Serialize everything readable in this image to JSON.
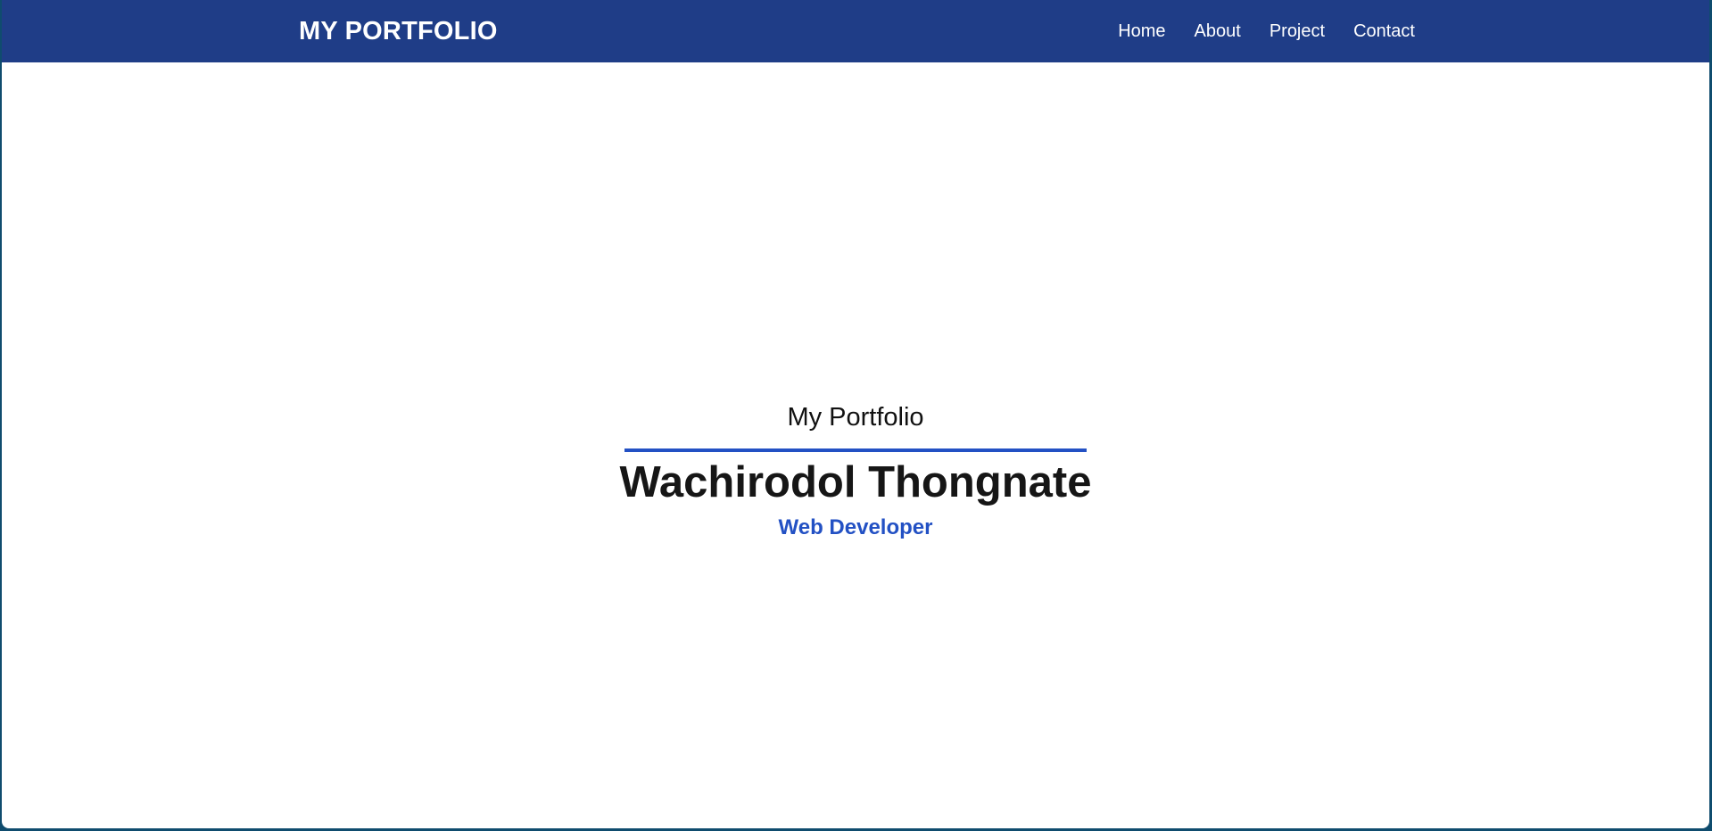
{
  "brand": "MY PORTFOLIO",
  "nav": {
    "items": [
      {
        "label": "Home"
      },
      {
        "label": "About"
      },
      {
        "label": "Project"
      },
      {
        "label": "Contact"
      }
    ]
  },
  "hero": {
    "subtitle": "My Portfolio",
    "name": "Wachirodol Thongnate",
    "role": "Web Developer"
  },
  "colors": {
    "navbar": "#1f3d87",
    "accent": "#2351c4",
    "window_border": "#0f4c6e",
    "background": "#ffffff",
    "text": "#161616"
  }
}
